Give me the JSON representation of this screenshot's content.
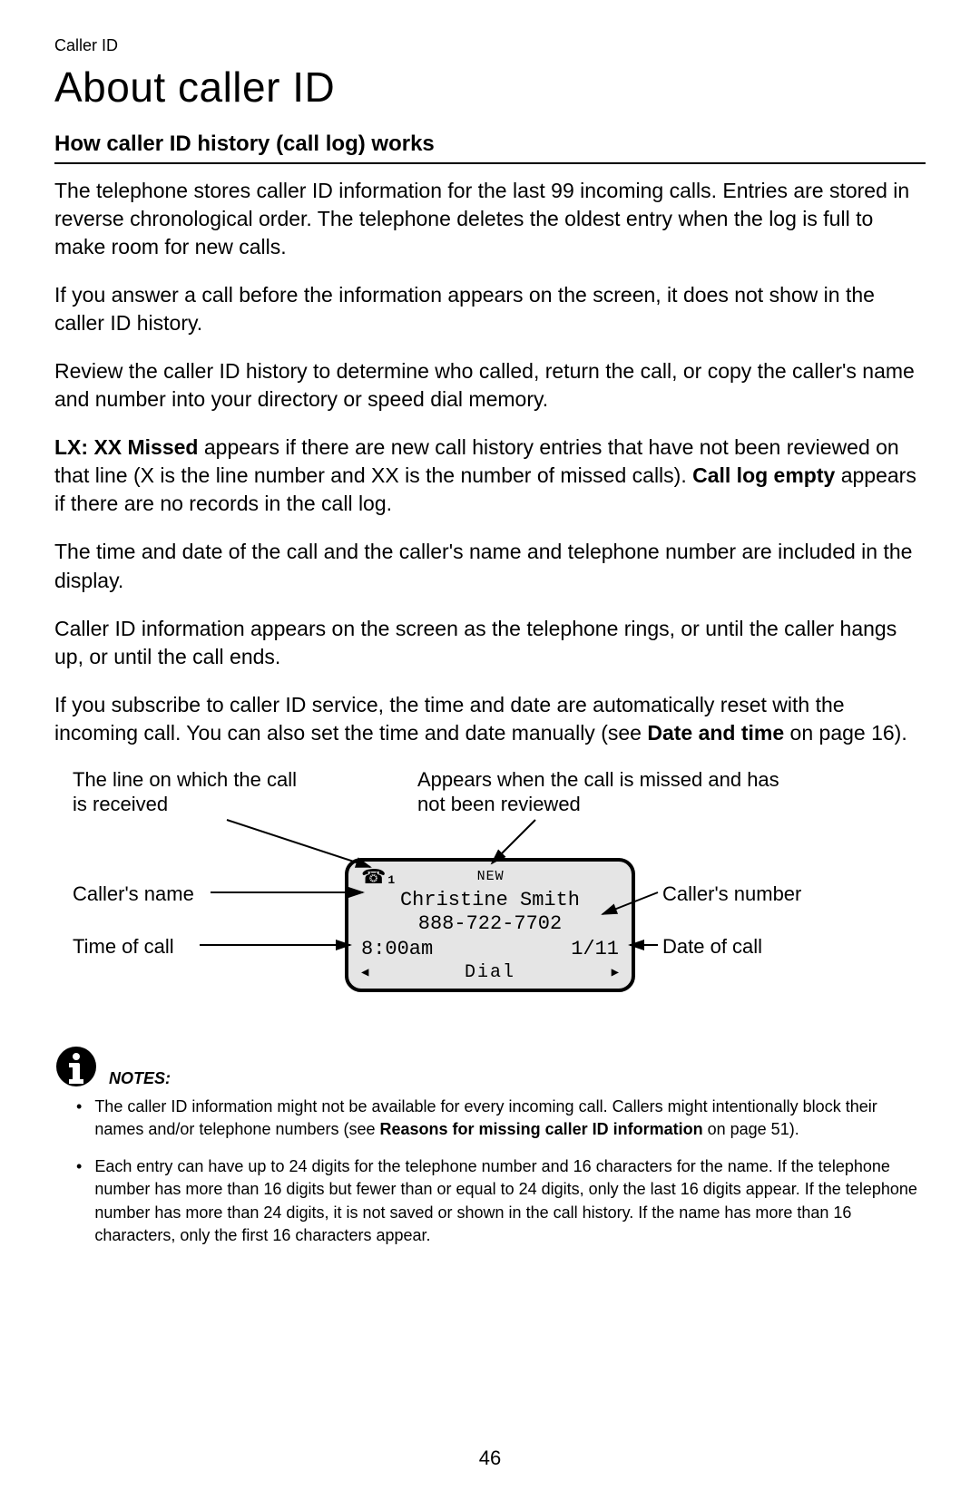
{
  "breadcrumb": "Caller ID",
  "title": "About caller ID",
  "section_heading": "How caller ID history (call log) works",
  "paragraphs": {
    "p1": "The telephone stores caller ID information for the last 99 incoming calls. Entries are stored in reverse chronological order. The telephone deletes the oldest entry when the log is full to make room for new calls.",
    "p2": "If you answer a call before the information appears on the screen, it does not show in the caller ID history.",
    "p3": "Review the caller ID history to determine who called, return the call, or copy the caller's name and number into your directory or speed dial memory.",
    "p4_prefix_bold": "LX: XX Missed",
    "p4_mid": " appears if there are new call history entries that have not been reviewed on that line (X is the line number and XX is the number of missed calls). ",
    "p4_bold2": "Call log empty",
    "p4_end": " appears if there are no records in the call log.",
    "p5": "The time and date of the call and the caller's name and telephone number are included in the display.",
    "p6": "Caller ID information appears on the screen as the telephone rings, or until the caller hangs up, or until the call ends.",
    "p7_start": "If you subscribe to caller ID service, the time and date are automatically reset with the incoming call. You can also set the time and date manually (see ",
    "p7_bold": "Date and time",
    "p7_end": " on page 16)."
  },
  "diagram": {
    "label_line": "The line on which the call is received",
    "label_new": "Appears when the call is missed and has not been reviewed",
    "label_name": "Caller's name",
    "label_number": "Caller's number",
    "label_time": "Time of call",
    "label_date": "Date of call",
    "lcd": {
      "line_indicator": "1",
      "new_badge": "NEW",
      "name": "Christine Smith",
      "number": "888-722-7702",
      "time": "8:00am",
      "date": "1/11",
      "softkey": "Dial"
    }
  },
  "notes": {
    "heading": "NOTES:",
    "n1_a": "The caller ID information might not be available for every incoming call. Callers might intentionally block their names and/or telephone numbers (see ",
    "n1_bold": "Reasons for missing caller ID information",
    "n1_b": " on page 51).",
    "n2": "Each entry can have up to 24 digits for the telephone number and 16 characters for the name. If the telephone number has more than 16 digits but fewer than or equal to 24 digits, only the last 16 digits appear. If the telephone number has more than 24 digits, it is not saved or shown in the call history. If the name has more than 16 characters, only the first 16 characters appear."
  },
  "page_number": "46"
}
